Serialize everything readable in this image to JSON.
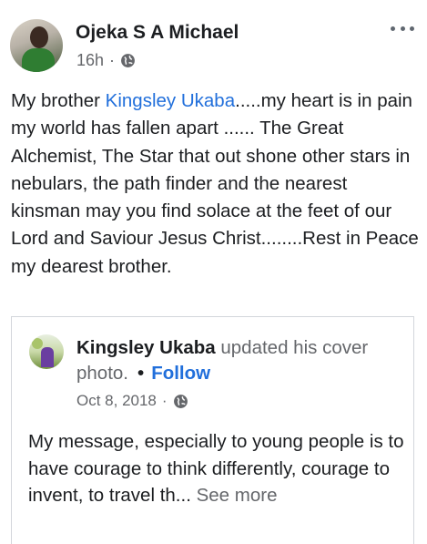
{
  "post": {
    "author": "Ojeka S A Michael",
    "time": "16h",
    "separator": "·",
    "privacy_icon": "globe-icon",
    "more_icon": "more-options-icon",
    "text_before_mention": "My brother ",
    "mention": "Kingsley Ukaba",
    "text_after_mention": ".....my heart is in pain my world has fallen apart ...... The Great Alchemist, The Star that out shone other stars in nebulars, the path finder and the nearest kinsman may you find solace at the feet of our Lord and Saviour Jesus Christ........Rest in Peace my dearest brother."
  },
  "shared": {
    "name": "Kingsley Ukaba",
    "action": " updated his cover photo.",
    "dot": "•",
    "follow_label": "Follow",
    "date": "Oct 8, 2018",
    "separator": "·",
    "privacy_icon": "globe-icon",
    "text": "My message, especially to young people is to have courage to think differently, courage to invent, to travel th...",
    "see_more": "See more"
  },
  "colors": {
    "link_blue": "#216fdb",
    "meta_gray": "#65676b",
    "text_dark": "#1c1e21"
  }
}
